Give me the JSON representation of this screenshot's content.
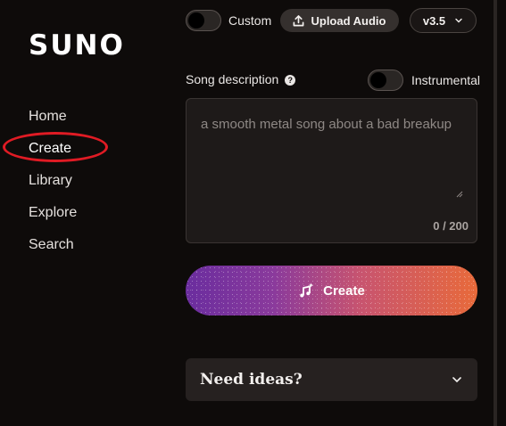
{
  "brand": {
    "logo_text": "SUNO"
  },
  "sidebar": {
    "items": [
      {
        "label": "Home"
      },
      {
        "label": "Create"
      },
      {
        "label": "Library"
      },
      {
        "label": "Explore"
      },
      {
        "label": "Search"
      }
    ],
    "active": "Create"
  },
  "top_bar": {
    "custom_label": "Custom",
    "custom_on": false,
    "upload_label": "Upload Audio",
    "version_label": "v3.5"
  },
  "form": {
    "description_label": "Song description",
    "instrumental_label": "Instrumental",
    "instrumental_on": false,
    "description_placeholder": "a smooth metal song about a bad breakup",
    "char_count": "0 / 200",
    "create_label": "Create"
  },
  "ideas": {
    "label": "Need ideas?"
  },
  "annotation": {
    "highlight_color": "#e01b24",
    "target": "Create"
  },
  "icons": [
    "help-icon",
    "upload-icon",
    "chevron-down-icon",
    "music-sparkle-icon",
    "resize-grip-icon"
  ]
}
